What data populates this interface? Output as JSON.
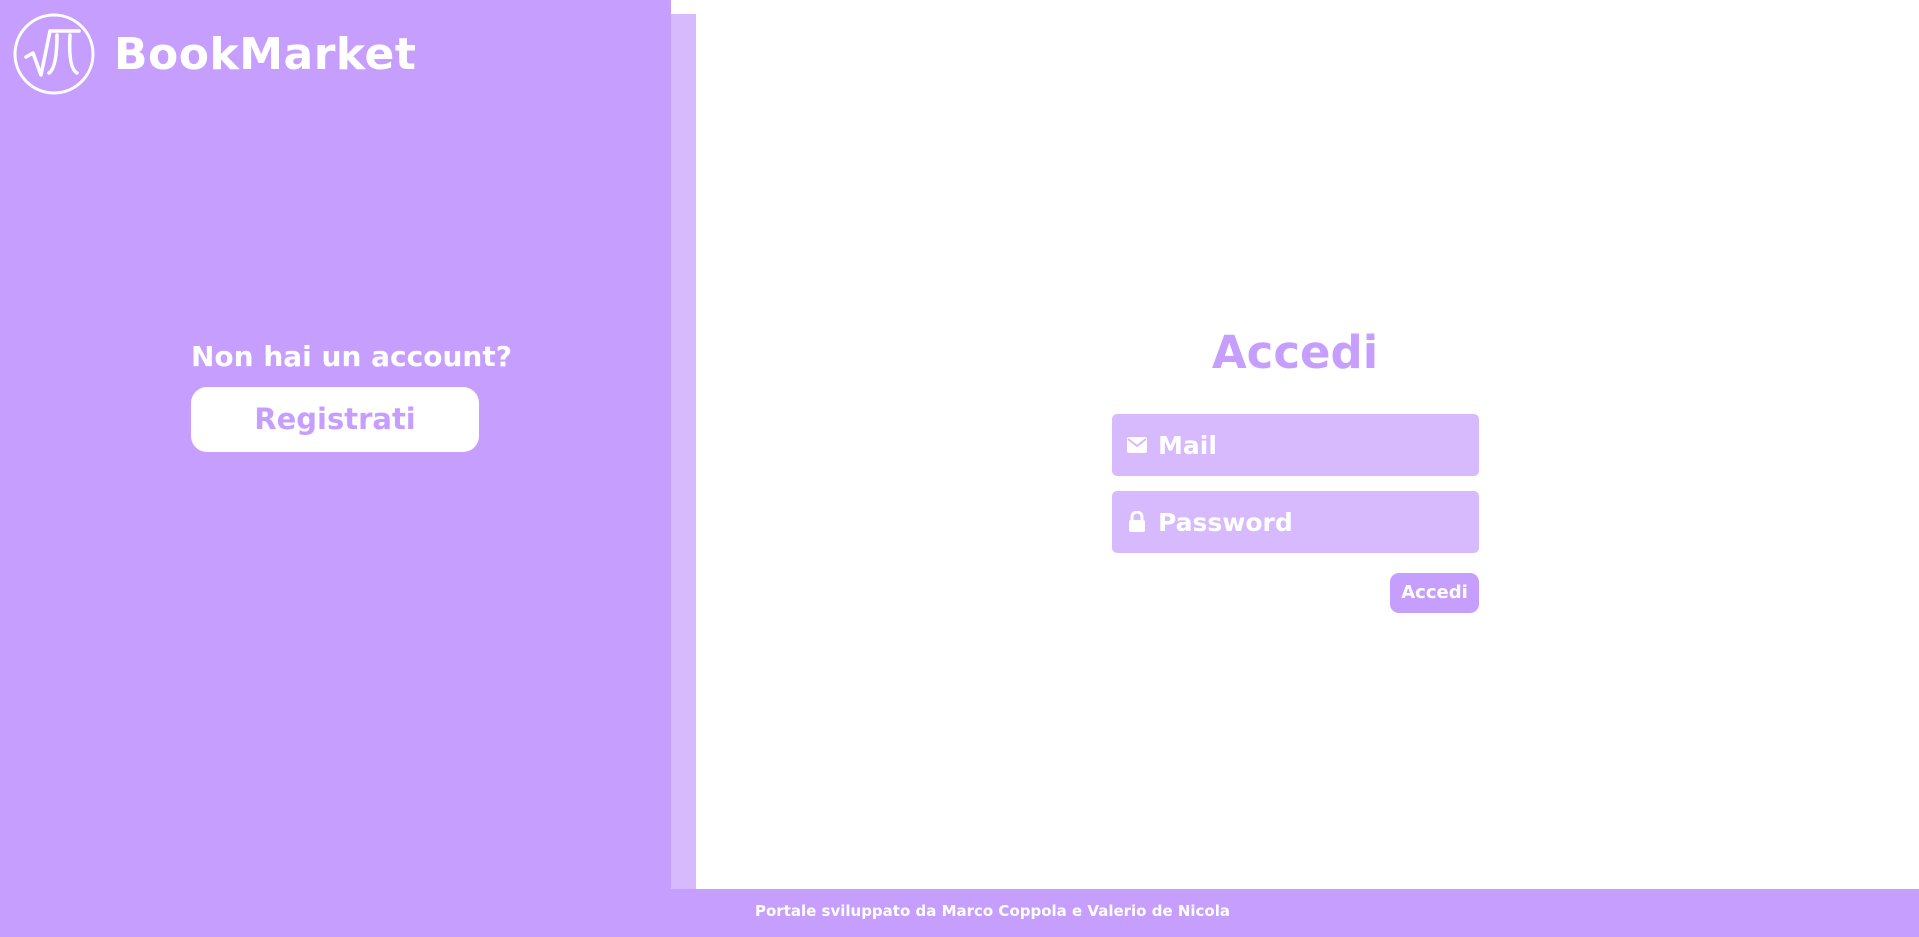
{
  "brand": {
    "name": "BookMarket",
    "logo_icon": "sqrt-pi-logo-icon"
  },
  "signup": {
    "question": "Non hai un account?",
    "button_label": "Registrati"
  },
  "login": {
    "title": "Accedi",
    "mail": {
      "placeholder": "Mail",
      "value": "",
      "icon": "envelope-icon"
    },
    "password": {
      "placeholder": "Password",
      "value": "",
      "icon": "lock-icon"
    },
    "submit_label": "Accedi"
  },
  "footer": {
    "text": "Portale sviluppato da Marco Coppola e Valerio de Nicola"
  },
  "colors": {
    "primary": "#c69ffe",
    "secondary": "#d7b9fe",
    "text_on_primary": "#ffffff"
  }
}
